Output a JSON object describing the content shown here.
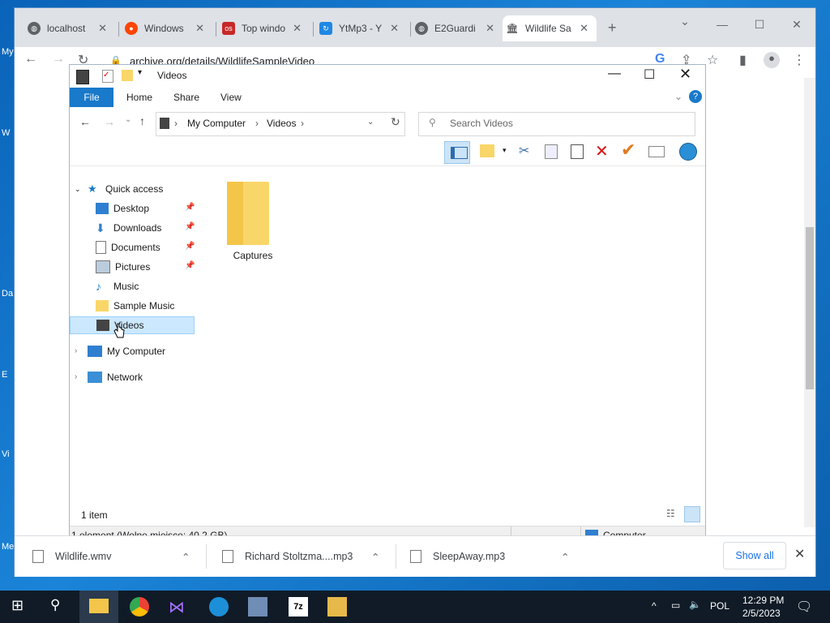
{
  "desktop": {
    "labels": [
      "My",
      "W",
      "Da",
      "E",
      "Vi",
      "Me"
    ]
  },
  "chrome": {
    "tabs": [
      {
        "label": "localhost",
        "color": "#5f6368"
      },
      {
        "label": "Windows",
        "color": "#ff4500"
      },
      {
        "label": "Top windo",
        "color": "#c62828"
      },
      {
        "label": "YtMp3 - Y",
        "color": "#1e88e5"
      },
      {
        "label": "E2Guardi",
        "color": "#5f6368"
      },
      {
        "label": "Wildlife Sa",
        "color": "#202124"
      }
    ],
    "url": "archive.org/details/WildlifeSampleVideo"
  },
  "explorer": {
    "title": "Videos",
    "ribbon": {
      "file": "File",
      "home": "Home",
      "share": "Share",
      "view": "View"
    },
    "breadcrumb": [
      "My Computer",
      "Videos"
    ],
    "search_placeholder": "Search Videos",
    "nav": {
      "quick_access": "Quick access",
      "items": [
        {
          "label": "Desktop",
          "pinned": true
        },
        {
          "label": "Downloads",
          "pinned": true
        },
        {
          "label": "Documents",
          "pinned": true
        },
        {
          "label": "Pictures",
          "pinned": true
        },
        {
          "label": "Music",
          "pinned": false
        },
        {
          "label": "Sample Music",
          "pinned": false
        },
        {
          "label": "Videos",
          "pinned": false
        }
      ],
      "my_computer": "My Computer",
      "network": "Network"
    },
    "content": {
      "folder": "Captures"
    },
    "status": {
      "count": "1 item",
      "bar": "1 element (Wolne miejsce: 40.2 GB)",
      "location": "Computer"
    }
  },
  "downloads": {
    "items": [
      "Wildlife.wmv",
      "Richard Stoltzma....mp3",
      "SleepAway.mp3"
    ],
    "show_all": "Show all"
  },
  "taskbar": {
    "lang": "POL",
    "time": "12:29 PM",
    "date": "2/5/2023"
  }
}
